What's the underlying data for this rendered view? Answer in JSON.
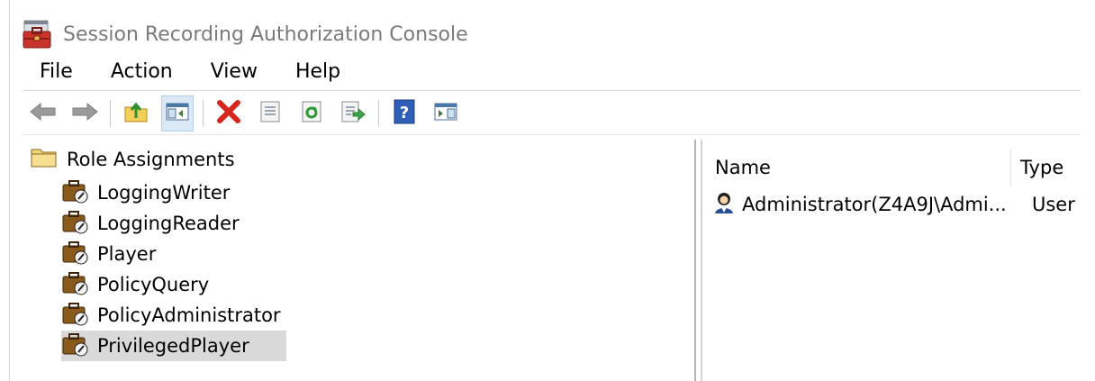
{
  "window": {
    "title": "Session Recording Authorization Console",
    "app_icon": "briefcase-console-icon"
  },
  "menu": [
    "File",
    "Action",
    "View",
    "Help"
  ],
  "toolbar": [
    {
      "icon": "back-arrow-icon",
      "enabled": false
    },
    {
      "icon": "forward-arrow-icon",
      "enabled": false
    },
    {
      "icon": "up-folder-icon",
      "enabled": true
    },
    {
      "icon": "show-hide-console-tree-icon",
      "enabled": true,
      "pressed": true
    },
    {
      "icon": "delete-icon",
      "enabled": true
    },
    {
      "icon": "properties-icon",
      "enabled": true
    },
    {
      "icon": "refresh-icon",
      "enabled": true
    },
    {
      "icon": "export-list-icon",
      "enabled": true
    },
    {
      "icon": "help-icon",
      "enabled": true
    },
    {
      "icon": "show-hide-action-pane-icon",
      "enabled": true
    }
  ],
  "tree": {
    "root": {
      "label": "Role Assignments",
      "icon": "folder-icon"
    },
    "children": [
      {
        "label": "LoggingWriter",
        "icon": "role-icon"
      },
      {
        "label": "LoggingReader",
        "icon": "role-icon"
      },
      {
        "label": "Player",
        "icon": "role-icon"
      },
      {
        "label": "PolicyQuery",
        "icon": "role-icon"
      },
      {
        "label": "PolicyAdministrator",
        "icon": "role-icon"
      },
      {
        "label": "PrivilegedPlayer",
        "icon": "role-icon",
        "selected": true
      }
    ]
  },
  "list": {
    "columns": [
      "Name",
      "Type"
    ],
    "rows": [
      {
        "name": "Administrator(Z4A9J\\Admi...",
        "type": "User",
        "icon": "user-icon"
      }
    ]
  }
}
